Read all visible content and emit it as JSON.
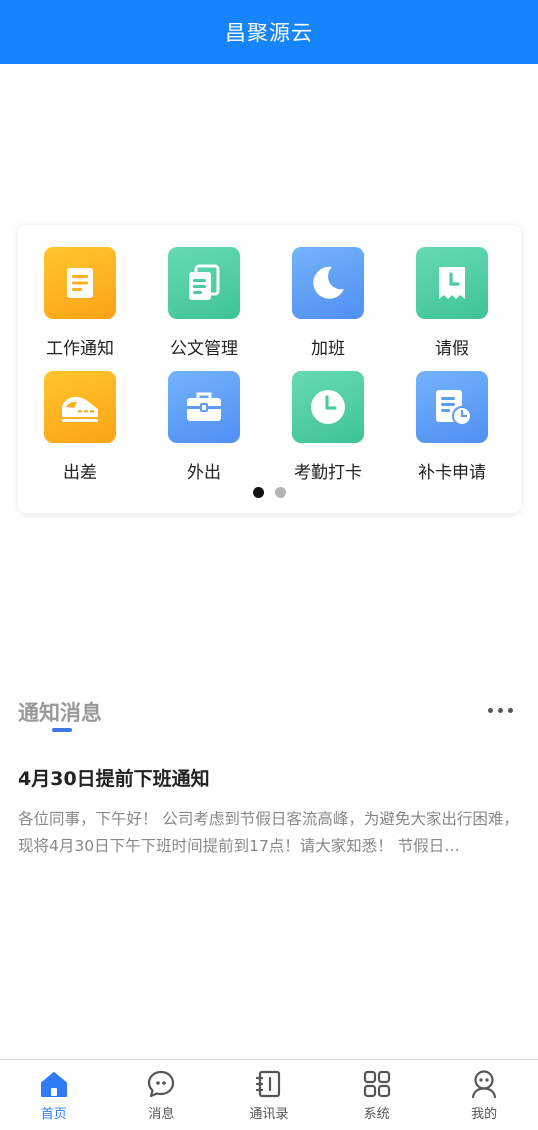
{
  "app": {
    "title": "昌聚源云"
  },
  "grid": {
    "items": [
      {
        "label": "工作通知",
        "icon": "document-icon"
      },
      {
        "label": "公文管理",
        "icon": "documents-stack-icon"
      },
      {
        "label": "加班",
        "icon": "moon-icon"
      },
      {
        "label": "请假",
        "icon": "clock-receipt-icon"
      },
      {
        "label": "出差",
        "icon": "train-icon"
      },
      {
        "label": "外出",
        "icon": "briefcase-icon"
      },
      {
        "label": "考勤打卡",
        "icon": "clock-icon"
      },
      {
        "label": "补卡申请",
        "icon": "form-clock-icon"
      }
    ],
    "page_indicator": {
      "current": 1,
      "total": 2
    }
  },
  "notices": {
    "heading": "通知消息",
    "items": [
      {
        "title": "4月30日提前下班通知",
        "summary": "各位同事，下午好！ 公司考虑到节假日客流高峰，为避免大家出行困难，现将4月30日下午下班时间提前到17点！请大家知悉！ 节假日…"
      }
    ]
  },
  "tabbar": {
    "items": [
      {
        "label": "首页",
        "icon": "home-icon",
        "active": true
      },
      {
        "label": "消息",
        "icon": "chat-icon",
        "active": false
      },
      {
        "label": "通讯录",
        "icon": "address-book-icon",
        "active": false
      },
      {
        "label": "系统",
        "icon": "apps-grid-icon",
        "active": false
      },
      {
        "label": "我的",
        "icon": "user-icon",
        "active": false
      }
    ]
  },
  "colors": {
    "header": "#1684fc",
    "accent": "#2f7bf5",
    "orange": "#fca315",
    "green": "#3ec395",
    "blue": "#4f8ff2"
  }
}
